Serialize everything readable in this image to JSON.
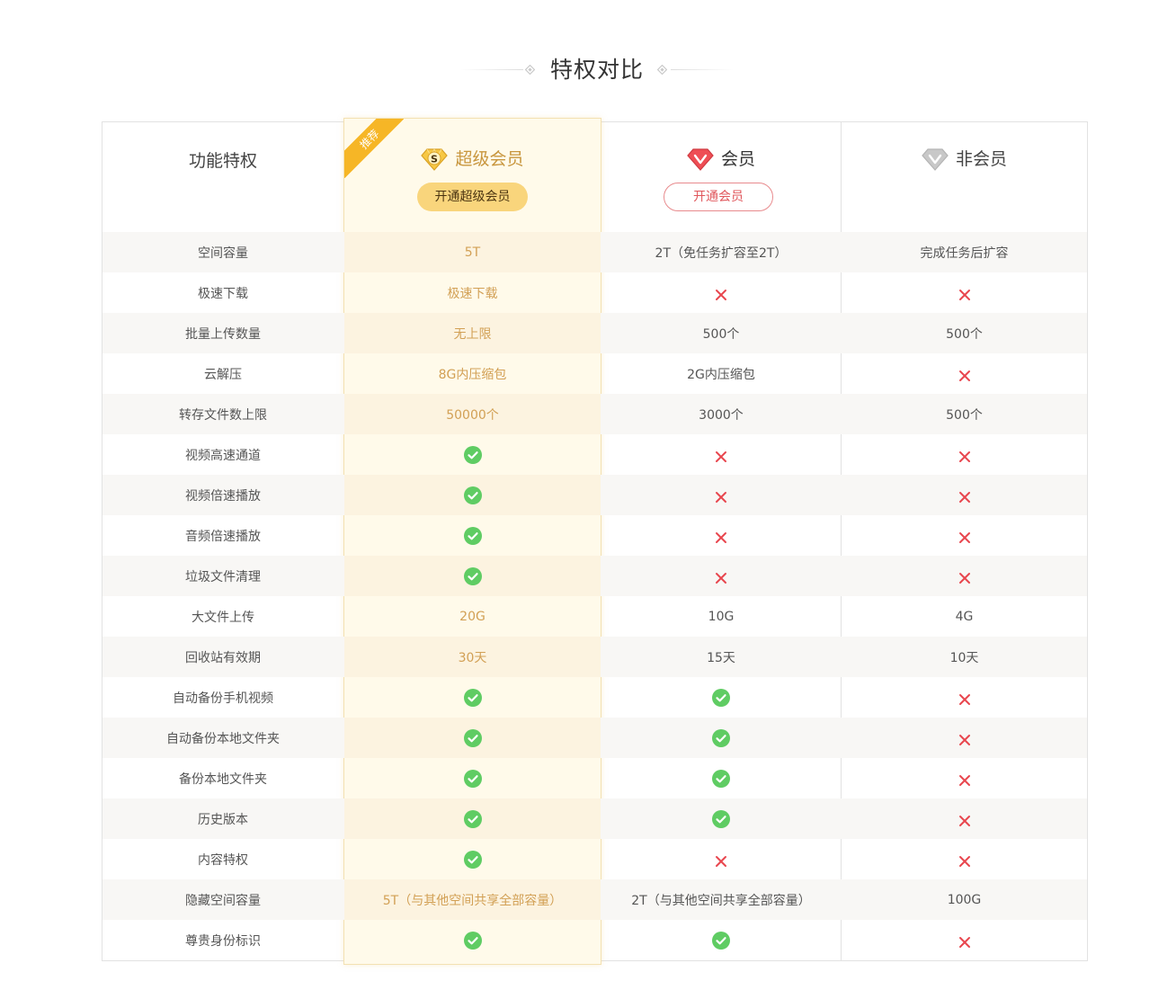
{
  "heading": {
    "title": "特权对比"
  },
  "table": {
    "feature_header": "功能特权",
    "plans": {
      "super": {
        "name": "超级会员",
        "badge_letter": "S",
        "ribbon": "推荐",
        "button": "开通超级会员"
      },
      "vip": {
        "name": "会员",
        "button": "开通会员"
      },
      "free": {
        "name": "非会员"
      }
    },
    "rows": [
      {
        "feature": "空间容量",
        "super": "5T",
        "vip": "2T（免任务扩容至2T）",
        "free": "完成任务后扩容"
      },
      {
        "feature": "极速下载",
        "super": "极速下载",
        "vip": "cross",
        "free": "cross"
      },
      {
        "feature": "批量上传数量",
        "super": "无上限",
        "vip": "500个",
        "free": "500个"
      },
      {
        "feature": "云解压",
        "super": "8G内压缩包",
        "vip": "2G内压缩包",
        "free": "cross"
      },
      {
        "feature": "转存文件数上限",
        "super": "50000个",
        "vip": "3000个",
        "free": "500个"
      },
      {
        "feature": "视频高速通道",
        "super": "check",
        "vip": "cross",
        "free": "cross"
      },
      {
        "feature": "视频倍速播放",
        "super": "check",
        "vip": "cross",
        "free": "cross"
      },
      {
        "feature": "音频倍速播放",
        "super": "check",
        "vip": "cross",
        "free": "cross"
      },
      {
        "feature": "垃圾文件清理",
        "super": "check",
        "vip": "cross",
        "free": "cross"
      },
      {
        "feature": "大文件上传",
        "super": "20G",
        "vip": "10G",
        "free": "4G"
      },
      {
        "feature": "回收站有效期",
        "super": "30天",
        "vip": "15天",
        "free": "10天"
      },
      {
        "feature": "自动备份手机视频",
        "super": "check",
        "vip": "check",
        "free": "cross"
      },
      {
        "feature": "自动备份本地文件夹",
        "super": "check",
        "vip": "check",
        "free": "cross"
      },
      {
        "feature": "备份本地文件夹",
        "super": "check",
        "vip": "check",
        "free": "cross"
      },
      {
        "feature": "历史版本",
        "super": "check",
        "vip": "check",
        "free": "cross"
      },
      {
        "feature": "内容特权",
        "super": "check",
        "vip": "cross",
        "free": "cross"
      },
      {
        "feature": "隐藏空间容量",
        "super": "5T（与其他空间共享全部容量）",
        "vip": "2T（与其他空间共享全部容量）",
        "free": "100G"
      },
      {
        "feature": "尊贵身份标识",
        "super": "check",
        "vip": "check",
        "free": "cross"
      }
    ]
  },
  "icons": {
    "check": "check-circle-icon",
    "cross": "cross-icon",
    "super_badge": "gold-diamond-badge-icon",
    "vip_badge": "red-diamond-badge-icon",
    "free_badge": "gray-diamond-badge-icon",
    "heading_ornament": "diamond-ornament-icon"
  },
  "colors": {
    "super_accent": "#c8963e",
    "super_button": "#f9d57c",
    "ribbon": "#f6b626",
    "vip_accent": "#e0565b",
    "check_green": "#5fcc63",
    "cross_red": "#e8464e",
    "super_column_bg": "#fffaea"
  }
}
